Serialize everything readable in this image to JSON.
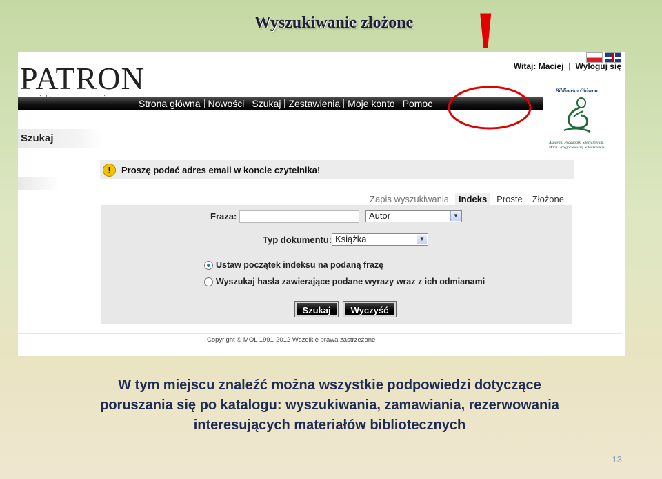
{
  "slide": {
    "title": "Wyszukiwanie złożone",
    "exclamation": "!",
    "caption_lines": [
      "W tym miejscu znaleźć można wszystkie podpowiedzi dotyczące",
      "poruszania się po katalogu: wyszukiwania, zamawiania, rezerwowania",
      "interesujących materiałów bibliotecznych"
    ],
    "page_number": "13"
  },
  "header": {
    "logo": "PATRON",
    "tagline": "zaprojektowany z precyzją",
    "greeting": "Witaj: Maciej",
    "logout": "Wyloguj się",
    "nav": [
      {
        "label": "Strona główna"
      },
      {
        "label": "Nowości"
      },
      {
        "label": "Szukaj"
      },
      {
        "label": "Zestawienia"
      },
      {
        "label": "Moje konto"
      },
      {
        "label": "Pomoc"
      }
    ]
  },
  "library": {
    "name": "Biblioteka Główna",
    "caption": "Akademii Pedagogiki Specjalnej im. Marii Grzegorzewskiej w Warszawie"
  },
  "page": {
    "section_label": "Szukaj",
    "warning": "Proszę podać adres email w koncie czytelnika!",
    "tabs": [
      {
        "label": "Zapis wyszukiwania",
        "state": "link"
      },
      {
        "label": "Indeks",
        "state": "active"
      },
      {
        "label": "Proste",
        "state": "normal"
      },
      {
        "label": "Złożone",
        "state": "normal"
      }
    ],
    "form": {
      "phrase_label": "Fraza:",
      "phrase_value": "",
      "field_select": "Autor",
      "doctype_label": "Typ dokumentu:",
      "doctype_select": "Książka",
      "radio1": "Ustaw początek indeksu na podaną frazę",
      "radio2": "Wyszukaj hasła zawierające podane wyrazy wraz z ich odmianami",
      "search_button": "Szukaj",
      "clear_button": "Wyczyść"
    },
    "copyright": "Copyright © MOL 1991-2012 Wszelkie prawa zastrzeżone"
  },
  "colors": {
    "highlight": "#e30000",
    "navbar": "#000000",
    "caption_text": "#1f2b52"
  }
}
